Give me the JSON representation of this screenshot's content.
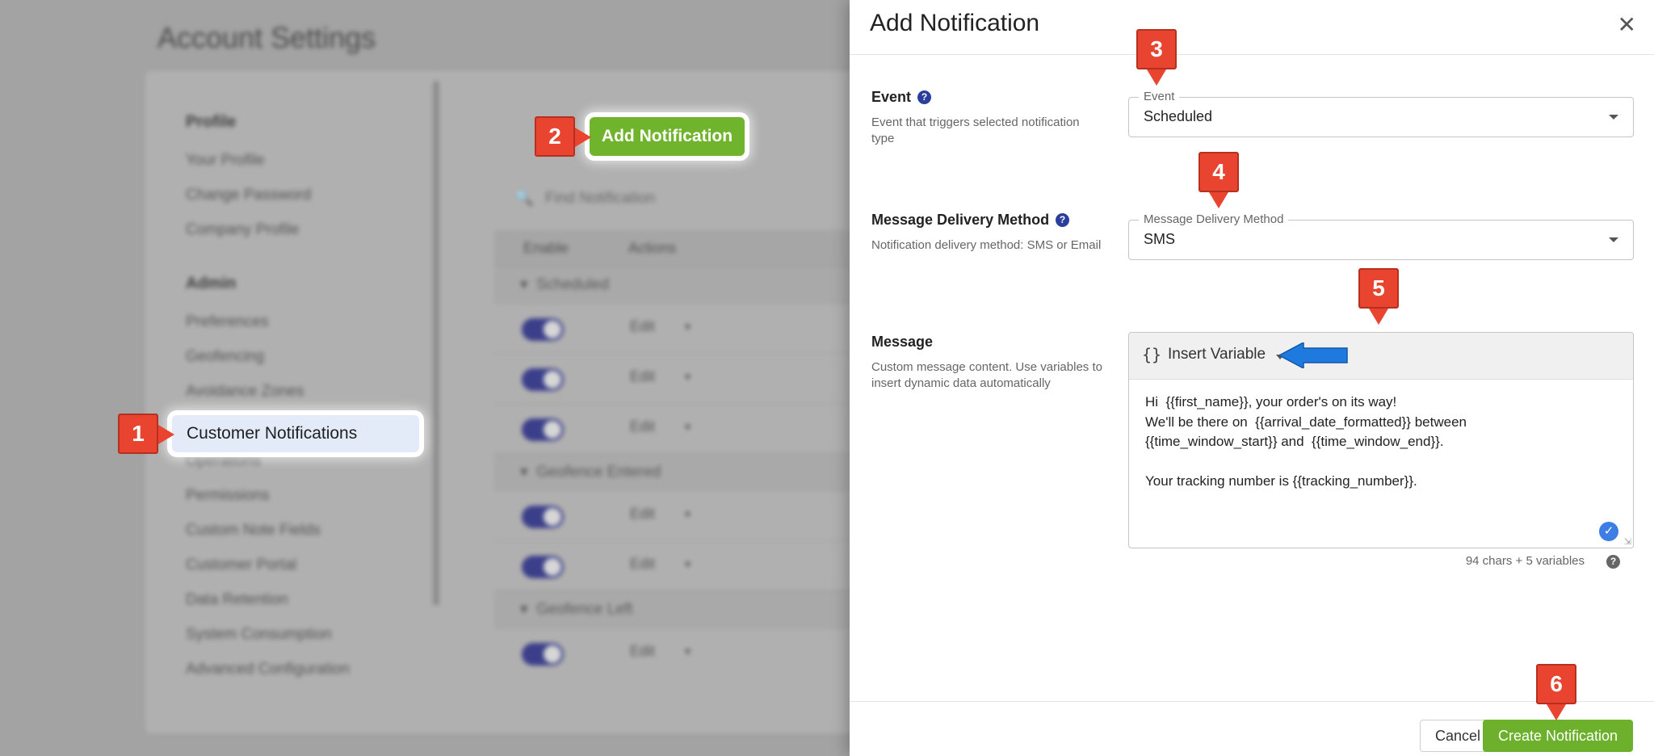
{
  "background": {
    "page_title": "Account Settings",
    "nav": {
      "section_profile": "Profile",
      "profile_items": [
        "Your Profile",
        "Change Password",
        "Company Profile"
      ],
      "section_admin": "Admin",
      "admin_items": [
        "Preferences",
        "Geofencing",
        "Avoidance Zones",
        "Customer Notifications",
        "Operations",
        "Permissions",
        "Custom Note Fields",
        "Customer Portal",
        "Data Retention",
        "System Consumption",
        "Advanced Configuration"
      ],
      "active_item": "Customer Notifications"
    },
    "add_button": "Add Notification",
    "search_placeholder": "Find Notification",
    "table": {
      "col_enable": "Enable",
      "col_actions": "Actions",
      "edit_label": "Edit",
      "groups": [
        "Scheduled",
        "Geofence Entered",
        "Geofence Left"
      ]
    }
  },
  "markers": [
    "1",
    "2",
    "3",
    "4",
    "5",
    "6"
  ],
  "drawer": {
    "title": "Add Notification",
    "event": {
      "label": "Event",
      "description": "Event that triggers selected notification type",
      "field_legend": "Event",
      "value": "Scheduled"
    },
    "delivery": {
      "label": "Message Delivery Method",
      "description": "Notification delivery method: SMS or Email",
      "field_legend": "Message Delivery Method",
      "value": "SMS"
    },
    "message": {
      "label": "Message",
      "description": "Custom message content. Use variables to insert dynamic data automatically",
      "insert_variable": "Insert Variable",
      "braces": "{}",
      "text": "Hi  {{first_name}}, your order's on its way!\nWe'll be there on  {{arrival_date_formatted}} between\n{{time_window_start}} and  {{time_window_end}}.\n\nYour tracking number is {{tracking_number}}.",
      "counter": "94 chars + 5 variables"
    },
    "cancel_label": "Cancel",
    "create_label": "Create Notification"
  },
  "colors": {
    "accent_green": "#6cb02b",
    "marker_red": "#e8442f",
    "help_blue": "#2a3f9c",
    "arrow_blue": "#1f7ae0"
  }
}
